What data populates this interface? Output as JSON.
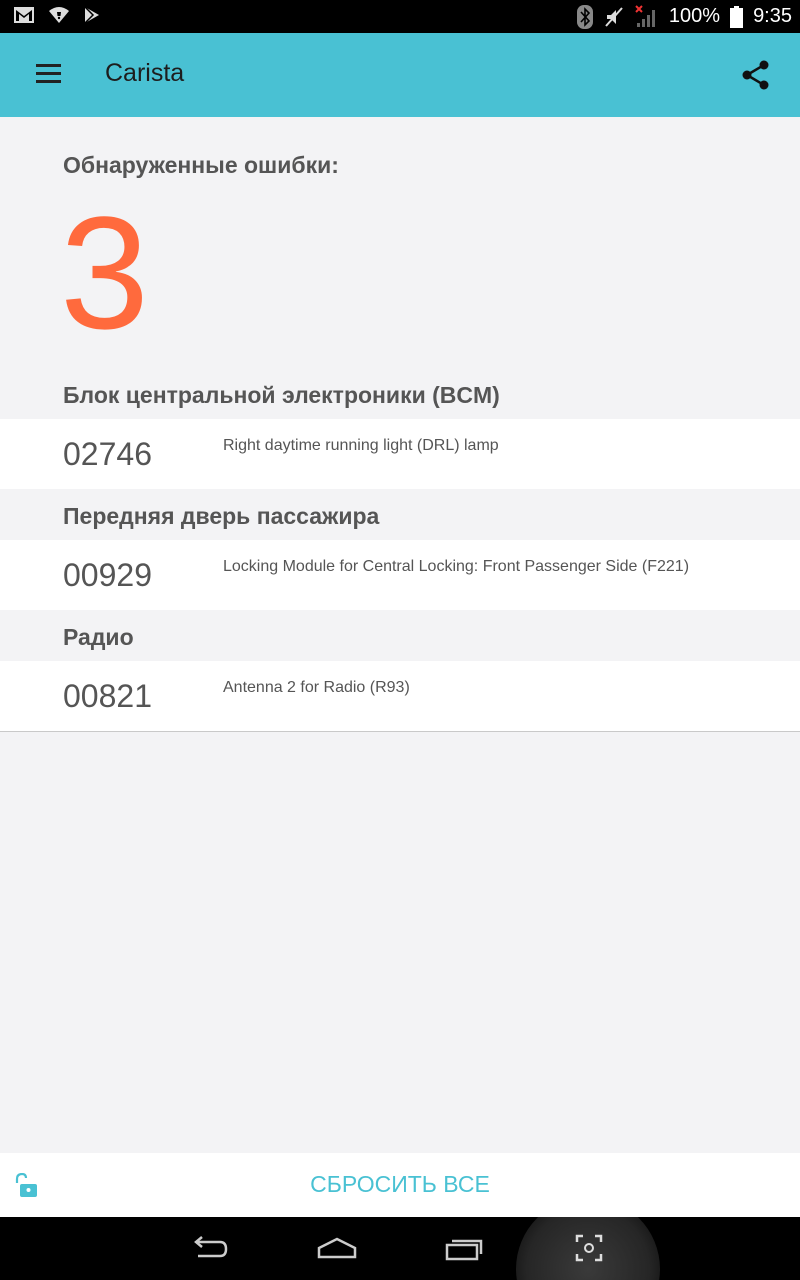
{
  "status_bar": {
    "battery": "100%",
    "time": "9:35"
  },
  "app_bar": {
    "title": "Carista"
  },
  "errors": {
    "heading": "Обнаруженные ошибки:",
    "count": "3"
  },
  "sections": [
    {
      "title": "Блок центральной электроники (BCM)",
      "code": "02746",
      "description": "Right daytime running light (DRL) lamp"
    },
    {
      "title": "Передняя дверь пассажира",
      "code": "00929",
      "description": "Locking Module for Central Locking: Front Passenger Side (F221)"
    },
    {
      "title": "Радио",
      "code": "00821",
      "description": "Antenna 2 for Radio (R93)"
    }
  ],
  "bottom_bar": {
    "reset_label": "СБРОСИТЬ ВСЕ"
  },
  "colors": {
    "accent": "#49c1d3",
    "error_count": "#ff6a3d"
  },
  "icons": [
    "gmail-icon",
    "wifi-icon",
    "play-store-icon",
    "bluetooth-icon",
    "mute-icon",
    "no-signal-icon",
    "battery-icon",
    "menu-icon",
    "share-icon",
    "unlock-icon",
    "back-icon",
    "home-icon",
    "recents-icon",
    "screenshot-icon"
  ]
}
